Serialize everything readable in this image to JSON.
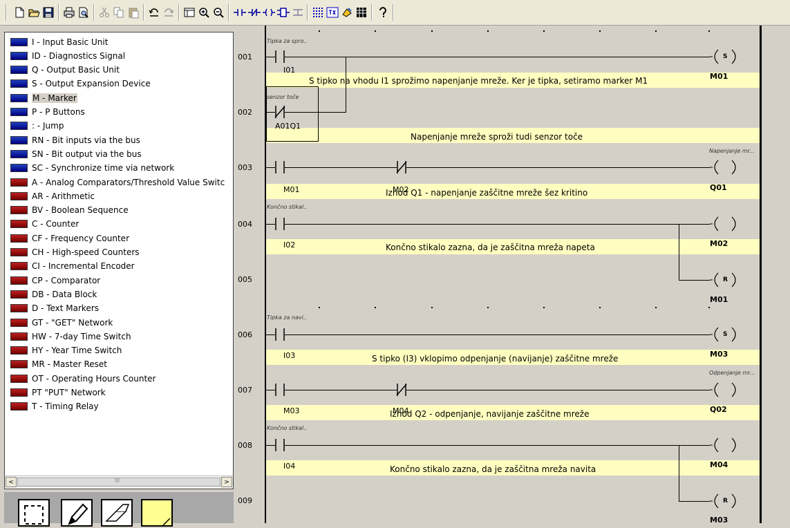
{
  "toolbar": {
    "icons": [
      "new-icon",
      "open-icon",
      "save-icon",
      "print-icon",
      "print-preview-icon",
      "cut-icon",
      "copy-icon",
      "paste-icon",
      "undo-icon",
      "redo-icon",
      "view-icon",
      "zoom-in-icon",
      "zoom-out-icon",
      "contact-icon",
      "nc-contact-icon",
      "coil-icon",
      "function-block-icon",
      "connection-icon",
      "grid-icon",
      "text-icon",
      "paint-icon",
      "table-icon",
      "help-icon"
    ]
  },
  "tree": {
    "items": [
      {
        "label": "I - Input Basic Unit",
        "color": "blue"
      },
      {
        "label": "ID - Diagnostics Signal",
        "color": "blue"
      },
      {
        "label": "Q - Output Basic Unit",
        "color": "blue"
      },
      {
        "label": "S - Output Expansion Device",
        "color": "blue"
      },
      {
        "label": "M - Marker",
        "color": "blue",
        "selected": true
      },
      {
        "label": "P - P Buttons",
        "color": "blue"
      },
      {
        "label": ": - Jump",
        "color": "blue"
      },
      {
        "label": "RN - Bit inputs via the bus",
        "color": "blue"
      },
      {
        "label": "SN - Bit output via the bus",
        "color": "blue"
      },
      {
        "label": "SC - Synchronize time via network",
        "color": "blue"
      },
      {
        "label": "A - Analog Comparators/Threshold Value Switc",
        "color": "red"
      },
      {
        "label": "AR - Arithmetic",
        "color": "red"
      },
      {
        "label": "BV - Boolean Sequence",
        "color": "red"
      },
      {
        "label": "C - Counter",
        "color": "red"
      },
      {
        "label": "CF - Frequency Counter",
        "color": "red"
      },
      {
        "label": "CH - High-speed Counters",
        "color": "red"
      },
      {
        "label": "CI - Incremental Encoder",
        "color": "red"
      },
      {
        "label": "CP - Comparator",
        "color": "red"
      },
      {
        "label": "DB - Data Block",
        "color": "red"
      },
      {
        "label": "D - Text Markers",
        "color": "red"
      },
      {
        "label": "GT - \"GET\" Network",
        "color": "red"
      },
      {
        "label": "HW - 7-day Time Switch",
        "color": "red"
      },
      {
        "label": "HY - Year Time Switch",
        "color": "red"
      },
      {
        "label": "MR - Master Reset",
        "color": "red"
      },
      {
        "label": "OT - Operating Hours Counter",
        "color": "red"
      },
      {
        "label": "PT \"PUT\" Network",
        "color": "red"
      },
      {
        "label": "T - Timing Relay",
        "color": "red"
      }
    ],
    "scroll_left": "<",
    "scroll_right": ">",
    "scroll_grip": "III"
  },
  "tools": [
    "select-tool-icon",
    "pencil-tool-icon",
    "eraser-tool-icon",
    "note-tool-icon"
  ],
  "ladder": {
    "rows": [
      "001",
      "002",
      "003",
      "004",
      "005",
      "006",
      "007",
      "008",
      "009"
    ],
    "tiny_labels": {
      "r1": "Tipka za spro..",
      "r2": "senzor toče",
      "r3": "Napenjanje mr...",
      "r4": "Končno stikal..",
      "r6": "Tipka za navi..",
      "r7": "Odpenjanje mr...",
      "r8": "Končno stikal.."
    },
    "operands": {
      "i01": "I01",
      "a01q1": "A01Q1",
      "m01": "M01",
      "m02": "M02",
      "i02": "I02",
      "i03": "I03",
      "m03": "M03",
      "m04": "M04",
      "i04": "I04"
    },
    "targets": {
      "r1": "M01",
      "r3": "Q01",
      "r4": "M02",
      "r5": "M01",
      "r6": "M03",
      "r7": "Q02",
      "r8": "M04",
      "r9": "M03"
    },
    "coils": {
      "r1": "S",
      "r3": "",
      "r4": "",
      "r5": "R",
      "r6": "S",
      "r7": "",
      "r8": "",
      "r9": "R"
    },
    "comments": {
      "r1": "S tipko na vhodu I1 sprožimo napenjanje mreže. Ker je tipka, setiramo marker M1",
      "r2": "Napenjanje mreže sproži tudi senzor toče",
      "r3": "Izhod Q1 - napenjanje zaščitne mreže šez kritino",
      "r4": "Končno stikalo zazna, da je zaščitna mreža napeta",
      "r6": "S tipko (I3) vklopimo odpenjanje (navijanje) zaščitne mreže",
      "r7": "Izhod Q2 - odpenjanje, navijanje zaščitne mreže",
      "r8": "Končno stikalo zazna, da je zaščitna mreža navita"
    }
  }
}
